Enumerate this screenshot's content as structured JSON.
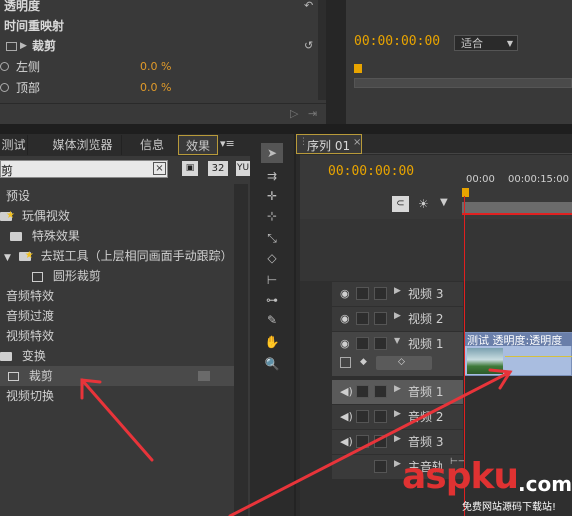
{
  "effect_controls": {
    "row_opacity": "透明度",
    "row_time_remap": "时间重映射",
    "row_crop": "裁剪",
    "left_label": "左侧",
    "left_value": "0.0 %",
    "top_label": "顶部",
    "top_value": "0.0 %"
  },
  "program_monitor": {
    "timecode": "00:00:00:00",
    "zoom_value": "适合"
  },
  "project_tabs": [
    "测试",
    "媒体浏览器",
    "信息",
    "效果"
  ],
  "search": {
    "value": "剪"
  },
  "filter_buttons": [
    "32",
    "YU"
  ],
  "effects_tree": [
    "预设",
    "玩偶视效",
    "特殊效果",
    "去斑工具（上层相同画面手动跟踪）",
    "圆形裁剪",
    "音频特效",
    "音频过渡",
    "视频特效",
    "变换",
    "裁剪",
    "视频切换"
  ],
  "sequence": {
    "tab_label": "序列 01",
    "timecode": "00:00:00:00",
    "ruler_start": "00:00",
    "ruler_mark": "00:00:15:00",
    "clip_label": "测试  透明度:透明度"
  },
  "tracks": {
    "v3": "视频 3",
    "v2": "视频 2",
    "v1": "视频 1",
    "a1": "音频 1",
    "a2": "音频 2",
    "a3": "音频 3",
    "master": "主音轨"
  },
  "watermark": {
    "brand": "aspku",
    "tld": ".com",
    "slogan": "免费网站源码下载站!"
  },
  "colors": {
    "timecode": "#e8a400",
    "playhead": "#e02020",
    "annotation_arrow": "#e8343a",
    "clip_video": "#a9bde0"
  }
}
